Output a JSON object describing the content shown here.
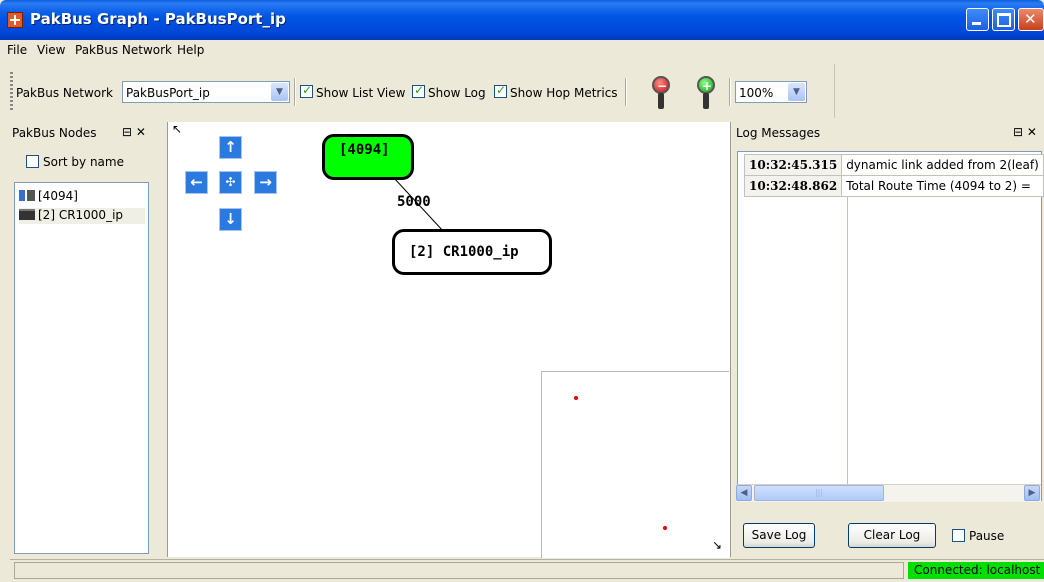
{
  "window": {
    "title": "PakBus Graph - PakBusPort_ip"
  },
  "menu": [
    "File",
    "View",
    "PakBus Network",
    "Help"
  ],
  "toolbar": {
    "network_label": "PakBus Network",
    "network_value": "PakBusPort_ip",
    "show_list_view": {
      "label": "Show List View",
      "checked": true
    },
    "show_log": {
      "label": "Show Log",
      "checked": true
    },
    "show_hop_metrics": {
      "label": "Show Hop Metrics",
      "checked": true
    },
    "zoom_out_icon": "zoom-out-icon",
    "zoom_in_icon": "zoom-in-icon",
    "zoom_value": "100%"
  },
  "nodes_panel": {
    "title": "PakBus Nodes",
    "controls": "⊟ ✕",
    "sort_by_name": {
      "label": "Sort by name",
      "checked": false
    },
    "items": [
      {
        "label": "[4094]",
        "icon": "network-server-icon"
      },
      {
        "label": "[2] CR1000_ip",
        "icon": "datalogger-icon",
        "selected": true
      }
    ]
  },
  "graph": {
    "nodes": [
      {
        "label": "[4094]",
        "color": "#00ff00"
      },
      {
        "label": "[2] CR1000_ip",
        "color": "#ffffff"
      }
    ],
    "link_label": "5000",
    "nav_icons": [
      "arrow-up-icon",
      "arrow-left-icon",
      "center-icon",
      "arrow-right-icon",
      "arrow-down-icon"
    ]
  },
  "log_panel": {
    "title": "Log Messages",
    "controls": "⊟ ✕",
    "rows": [
      {
        "time": "10:32:45.315",
        "message": "dynamic link added from 2(leaf)"
      },
      {
        "time": "10:32:48.862",
        "message": "Total Route Time (4094 to 2) ="
      }
    ],
    "save_label": "Save Log",
    "clear_label": "Clear Log",
    "pause": {
      "label": "Pause",
      "checked": false
    }
  },
  "status": {
    "connection": "Connected: localhost",
    "connection_color": "#00e000"
  }
}
